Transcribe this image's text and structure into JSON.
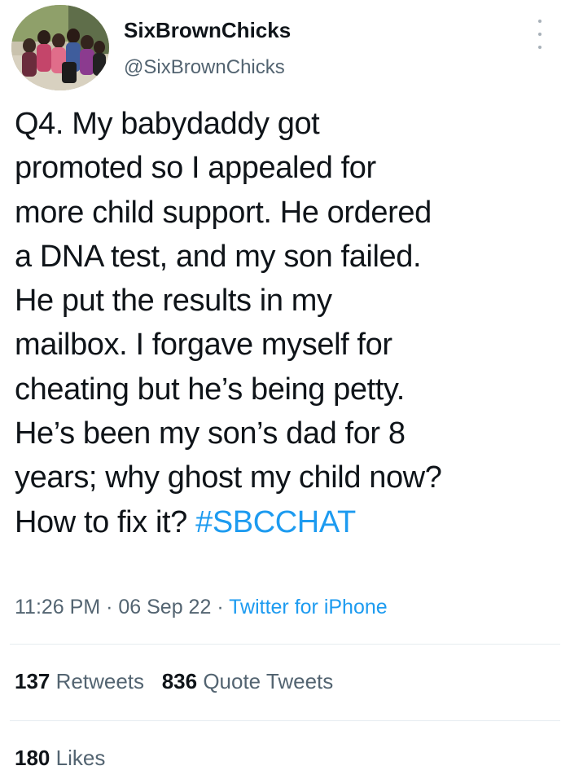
{
  "user": {
    "display_name": "SixBrownChicks",
    "handle": "@SixBrownChicks",
    "avatar_icon": "group-photo-avatar"
  },
  "tweet": {
    "lines": [
      "Q4. My babydaddy got",
      "promoted so I appealed for",
      "more child support. He ordered",
      "a DNA test, and my son failed.",
      "He put the results in my",
      "mailbox. I forgave myself for",
      "cheating but he’s being petty.",
      "He’s been my son’s dad for 8",
      "years; why ghost my child now?",
      "How to fix it?"
    ],
    "hashtag": "#SBCCHAT"
  },
  "meta": {
    "time": "11:26 PM",
    "separator": " · ",
    "date": "06 Sep 22",
    "source": "Twitter for iPhone"
  },
  "stats": {
    "retweets_count": "137",
    "retweets_label": "Retweets",
    "quotes_count": "836",
    "quotes_label": "Quote Tweets",
    "likes_count": "180",
    "likes_label": "Likes"
  },
  "colors": {
    "link": "#1d9bf0",
    "secondary": "#536471",
    "primary": "#0f1419"
  }
}
